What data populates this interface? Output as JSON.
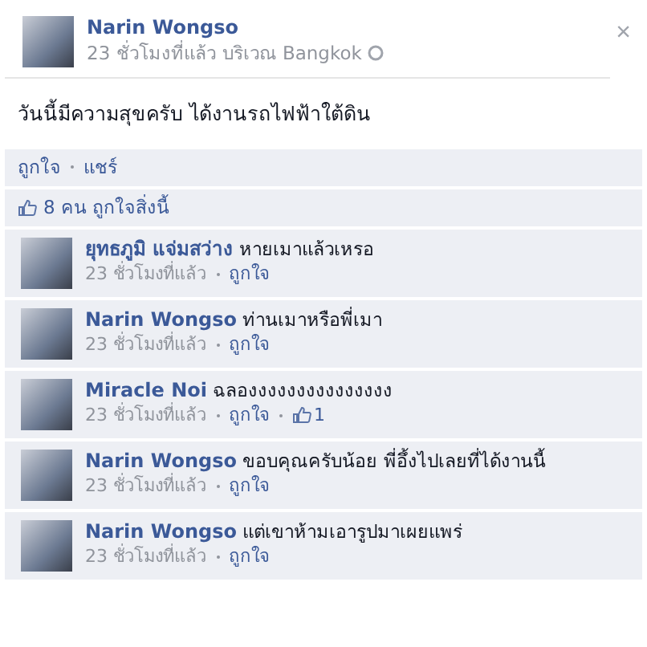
{
  "post": {
    "author": "Narin Wongso",
    "time": "23 ชั่วโมงที่แล้ว",
    "location": "บริเวณ Bangkok",
    "close": "×",
    "text": "วันนี้มีความสุขครับ ได้งานรถไฟฟ้าใต้ดิน"
  },
  "actions": [
    "ถูกใจ",
    "แชร์"
  ],
  "likes": {
    "text": "8 คน ถูกใจสิ่งนี้"
  },
  "comments": [
    {
      "author": "ยุทธภูมิ แจ่มสว่าง",
      "text": "หายเมาแล้วเหรอ",
      "time": "23 ชั่วโมงที่แล้ว",
      "like": "ถูกใจ"
    },
    {
      "author": "Narin Wongso",
      "text": "ท่านเมาหรือพี่เมา",
      "time": "23 ชั่วโมงที่แล้ว",
      "like": "ถูกใจ"
    },
    {
      "author": "Miracle Noi",
      "text": "ฉลองงงงงงงงงงงงงงง",
      "time": "23 ชั่วโมงที่แล้ว",
      "like": "ถูกใจ",
      "like_count": "1"
    },
    {
      "author": "Narin Wongso",
      "text": "ขอบคุณครับน้อย พี่อึ้งไปเลยที่ได้งานนี้",
      "time": "23 ชั่วโมงที่แล้ว",
      "like": "ถูกใจ"
    },
    {
      "author": "Narin Wongso",
      "text": "แต่เขาห้ามเอารูปมาเผยแพร่",
      "time": "23 ชั่วโมงที่แล้ว",
      "like": "ถูกใจ"
    }
  ]
}
